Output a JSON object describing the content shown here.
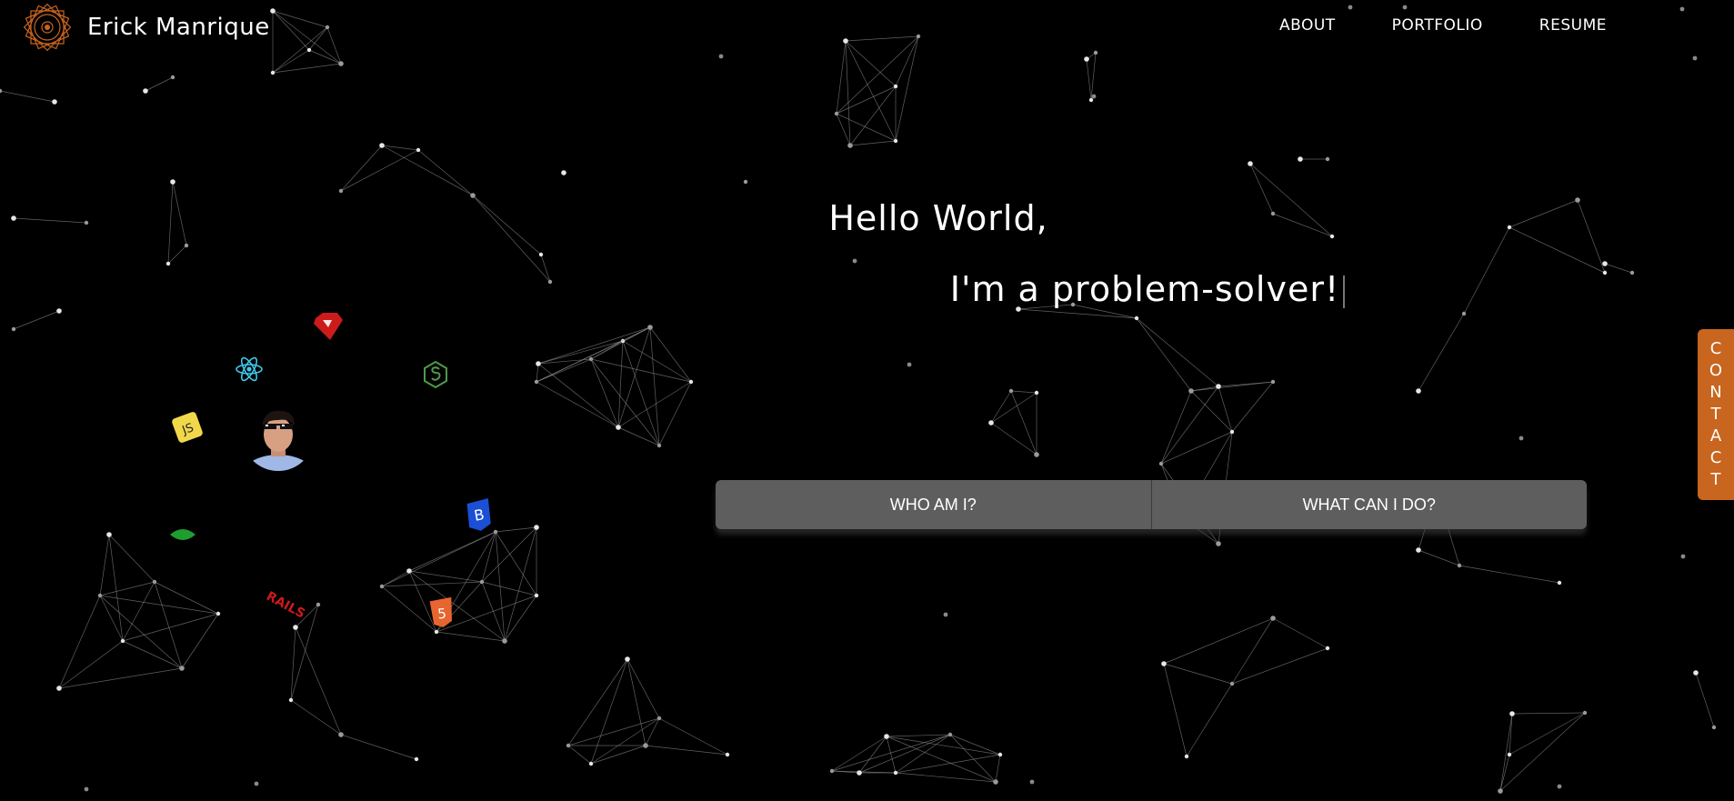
{
  "header": {
    "brand_name": "Erick Manrique",
    "logo_icon": "mandala-logo-icon",
    "accent_color": "#c8651f",
    "nav": [
      {
        "label": "ABOUT"
      },
      {
        "label": "PORTFOLIO"
      },
      {
        "label": "RESUME"
      }
    ]
  },
  "hero": {
    "greeting": "Hello World,",
    "tagline": "I'm a problem-solver!",
    "buttons": [
      {
        "label": "WHO AM I?"
      },
      {
        "label": "WHAT CAN I DO?"
      }
    ]
  },
  "contact_tab": {
    "letters": [
      "C",
      "O",
      "N",
      "T",
      "A",
      "C",
      "T"
    ]
  },
  "tech_icons": [
    {
      "name": "ruby-icon",
      "color": "#cc1b1b"
    },
    {
      "name": "react-icon",
      "color": "#3fc7e8"
    },
    {
      "name": "nodejs-icon",
      "color": "#4f9a49"
    },
    {
      "name": "javascript-icon",
      "color": "#f1d84b"
    },
    {
      "name": "bootstrap-icon",
      "color": "#1a4fd6"
    },
    {
      "name": "leaf-icon",
      "color": "#1e9e2f"
    },
    {
      "name": "rails-icon",
      "color": "#cc1b1b"
    },
    {
      "name": "html5-icon",
      "color": "#e7652e"
    }
  ],
  "colors": {
    "background": "#000000",
    "button_bg": "#5e5e5e",
    "network_line": "#9a9a9a"
  }
}
